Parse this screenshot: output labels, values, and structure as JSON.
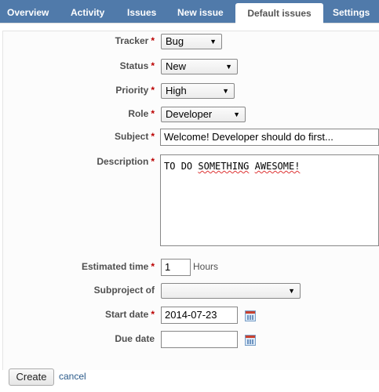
{
  "tabs": [
    {
      "label": "Overview"
    },
    {
      "label": "Activity"
    },
    {
      "label": "Issues"
    },
    {
      "label": "New issue"
    },
    {
      "label": "Default issues",
      "active": true
    },
    {
      "label": "Settings"
    }
  ],
  "form": {
    "tracker": {
      "label": "Tracker",
      "value": "Bug"
    },
    "status": {
      "label": "Status",
      "value": "New"
    },
    "priority": {
      "label": "Priority",
      "value": "High"
    },
    "role": {
      "label": "Role",
      "value": "Developer"
    },
    "subject": {
      "label": "Subject",
      "value": "Welcome! Developer should do first..."
    },
    "description": {
      "label": "Description",
      "words": [
        "TO",
        "DO",
        "SOMETHING",
        "AWESOME!"
      ]
    },
    "estimated_time": {
      "label": "Estimated time",
      "value": "1",
      "unit": "Hours"
    },
    "subproject": {
      "label": "Subproject of",
      "value": ""
    },
    "start_date": {
      "label": "Start date",
      "value": "2014-07-23"
    },
    "due_date": {
      "label": "Due date",
      "value": ""
    },
    "required_marker": "*"
  },
  "actions": {
    "create_label": "Create",
    "cancel_label": "cancel"
  },
  "icons": {
    "dropdown": "chevron-down-icon",
    "calendar": "calendar-icon"
  },
  "colors": {
    "tab_bar": "#507aaa",
    "required": "#bb0000",
    "link": "#2a5a8a"
  }
}
